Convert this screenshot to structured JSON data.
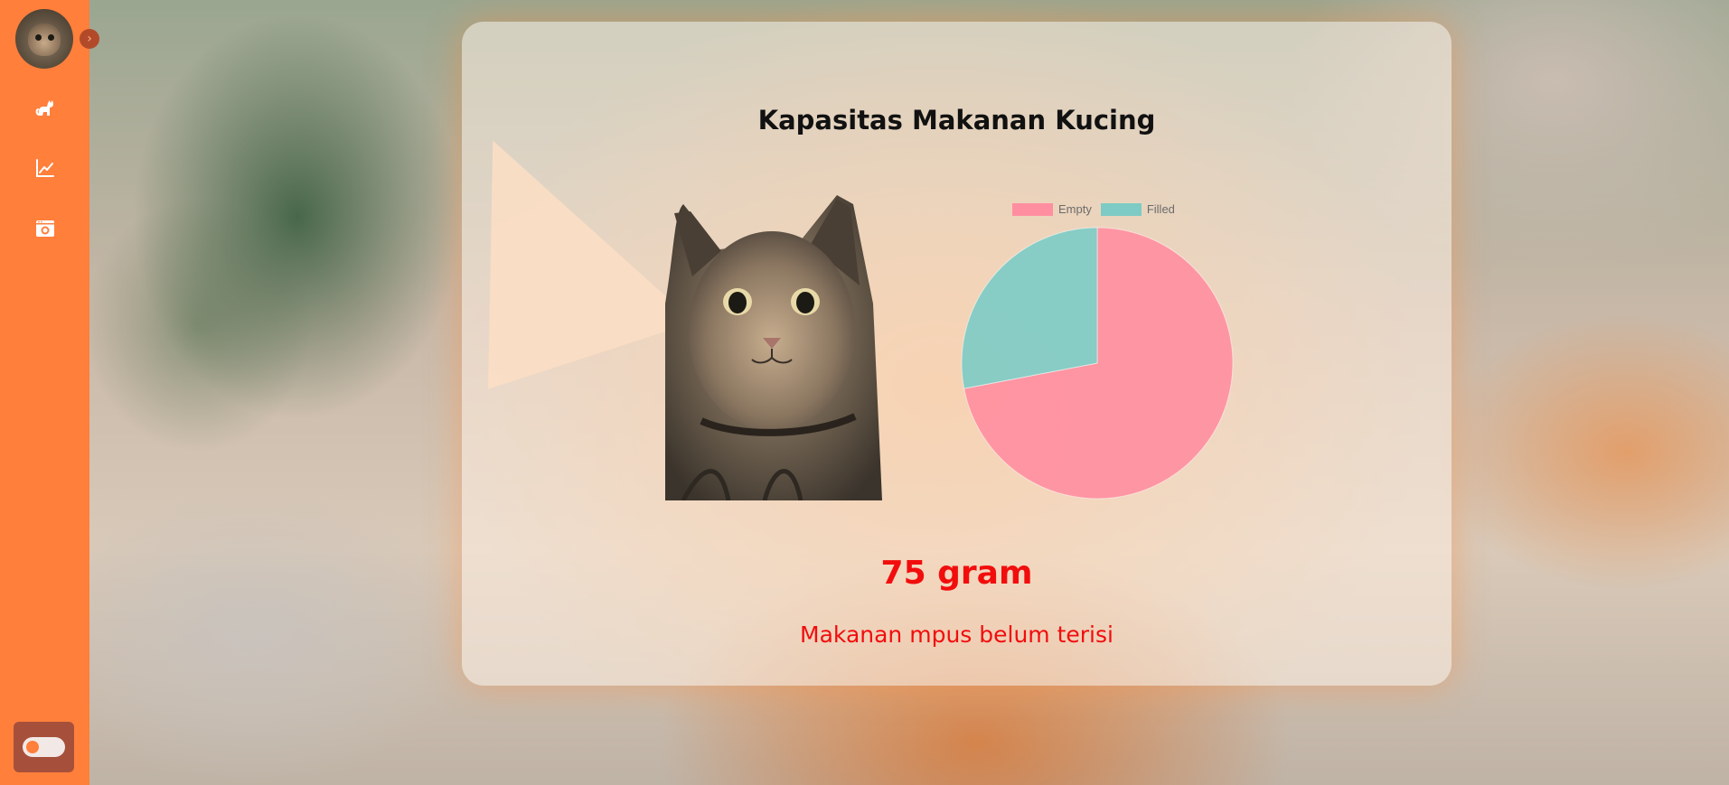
{
  "sidebar": {
    "avatar_icon": "cat-avatar",
    "collapse_icon": "chevron-right-icon",
    "collapse_glyph": "›",
    "items": [
      {
        "icon": "cat-icon"
      },
      {
        "icon": "line-chart-icon"
      },
      {
        "icon": "camera-icon"
      }
    ],
    "theme_toggle": {
      "state": "off"
    }
  },
  "card": {
    "title": "Kapasitas Makanan Kucing",
    "amount": "75 gram",
    "status": "Makanan mpus belum terisi"
  },
  "colors": {
    "sidebar": "#ff7f3b",
    "accent_text": "#f20d0d",
    "empty": "#ff8fa0",
    "filled": "#7ecbc5"
  },
  "chart_data": {
    "type": "pie",
    "title": "",
    "legend_position": "top",
    "categories": [
      "Empty",
      "Filled"
    ],
    "values": [
      72,
      28
    ]
  }
}
